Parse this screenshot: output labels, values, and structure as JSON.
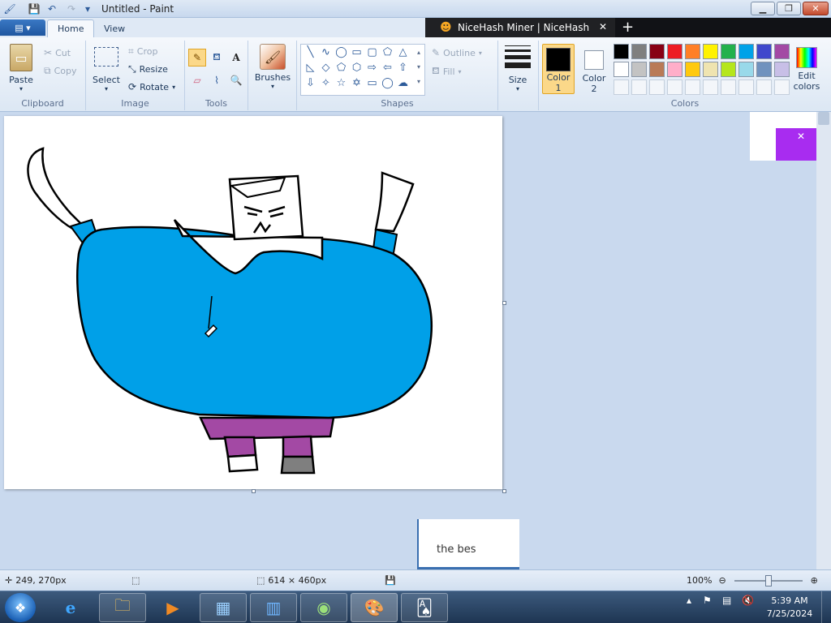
{
  "window": {
    "title": "Untitled - Paint"
  },
  "tabs": [
    {
      "label": "Home"
    },
    {
      "label": "View"
    }
  ],
  "browser": {
    "tab_title": "NiceHash Miner | NiceHash",
    "new_tab": "+",
    "close": "✕",
    "notification_text": "the bes"
  },
  "clipboard": {
    "paste": "Paste",
    "cut": "Cut",
    "copy": "Copy",
    "label": "Clipboard"
  },
  "image": {
    "select": "Select",
    "crop": "Crop",
    "resize": "Resize",
    "rotate": "Rotate",
    "label": "Image"
  },
  "tools": {
    "label": "Tools"
  },
  "brushes": {
    "label": "Brushes"
  },
  "shapes": {
    "label": "Shapes",
    "outline": "Outline",
    "fill": "Fill"
  },
  "size": {
    "label": "Size"
  },
  "colors": {
    "color1_label": "Color 1",
    "color2_label": "Color 2",
    "edit_label": "Edit colors",
    "label": "Colors",
    "color1": "#000000",
    "color2": "#ffffff",
    "palette_row1": [
      "#000000",
      "#7f7f7f",
      "#880015",
      "#ed1c24",
      "#ff7f27",
      "#fff200",
      "#22b14c",
      "#00a2e8",
      "#3f48cc",
      "#a349a4"
    ],
    "palette_row2": [
      "#ffffff",
      "#c3c3c3",
      "#b97a57",
      "#ffaec9",
      "#ffc90e",
      "#efe4b0",
      "#b5e61d",
      "#99d9ea",
      "#7092be",
      "#c8bfe7"
    ]
  },
  "status": {
    "cursor_pos": "249, 270px",
    "canvas_size": "614 × 460px",
    "zoom": "100%"
  },
  "drawing": {
    "body_color": "#00a0e8",
    "pants_color": "#a349a4",
    "boot_color": "#7f7f7f"
  },
  "taskbar": {
    "time": "5:39 AM",
    "date": "7/25/2024"
  }
}
